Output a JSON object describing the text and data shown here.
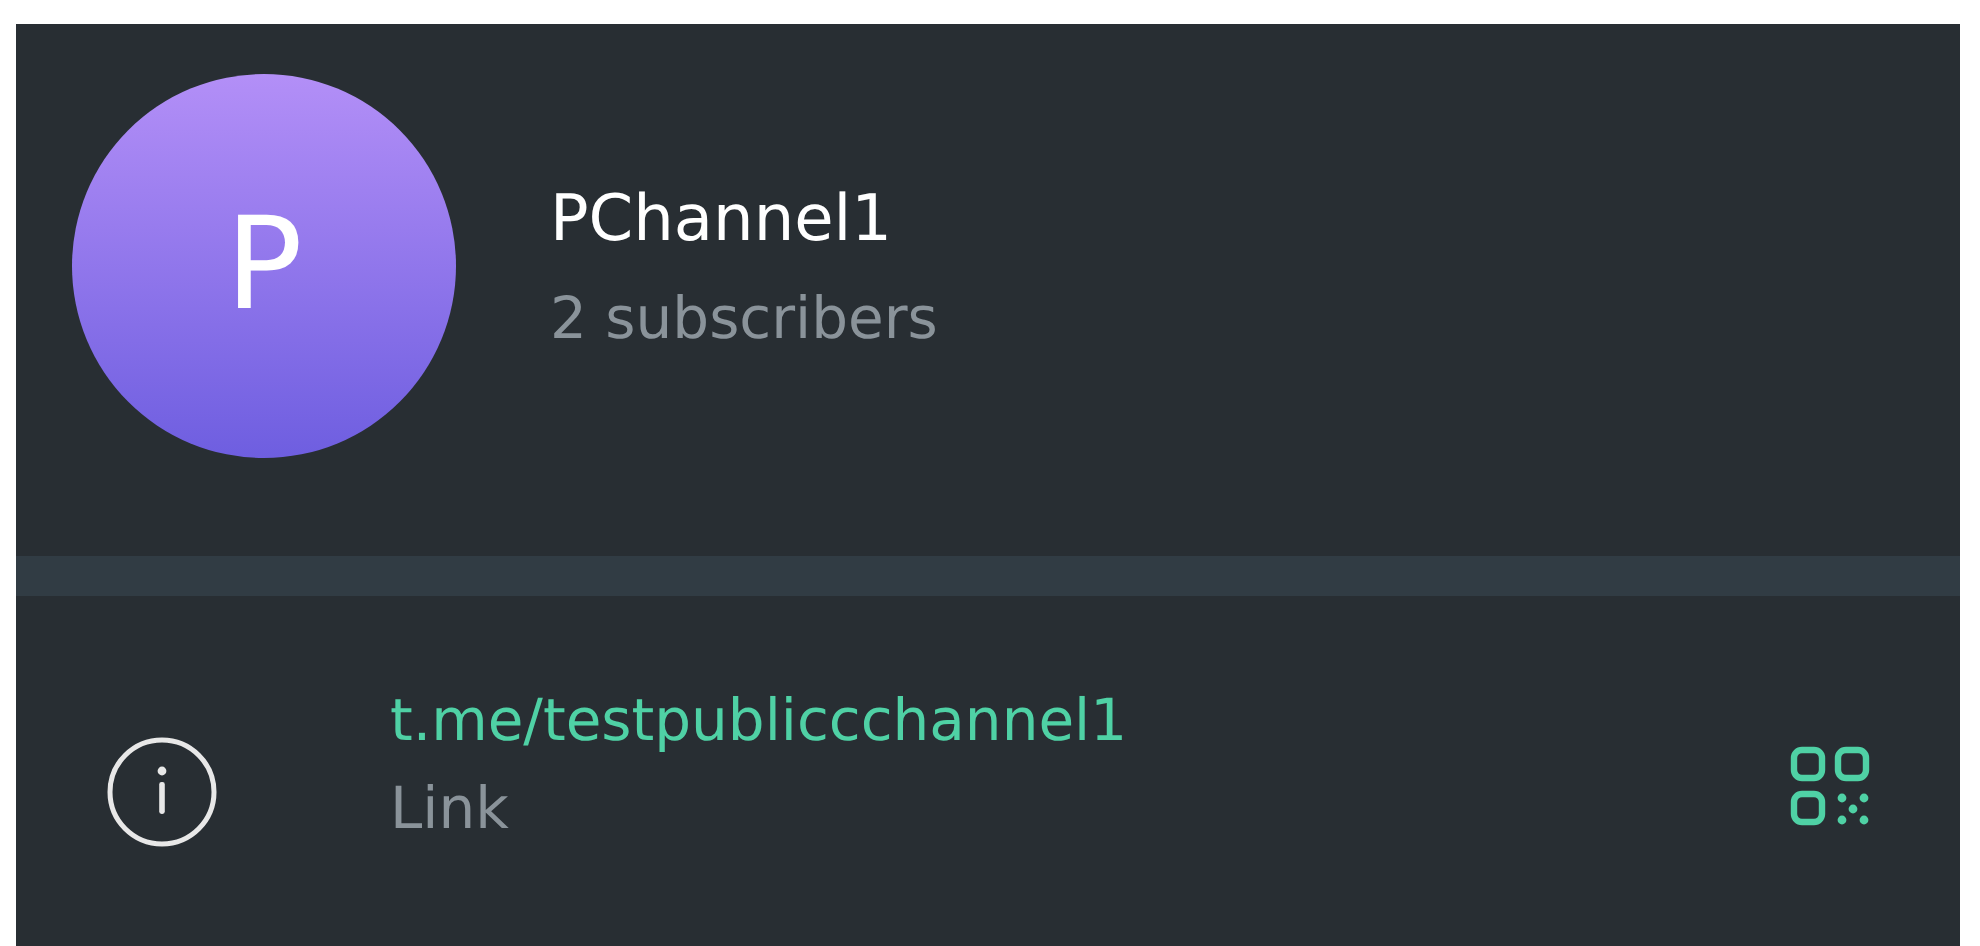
{
  "channel": {
    "avatar_letter": "P",
    "name": "PChannel1",
    "subscribers": "2 subscribers"
  },
  "info": {
    "link": "t.me/testpubliccchannel1",
    "label": "Link"
  }
}
